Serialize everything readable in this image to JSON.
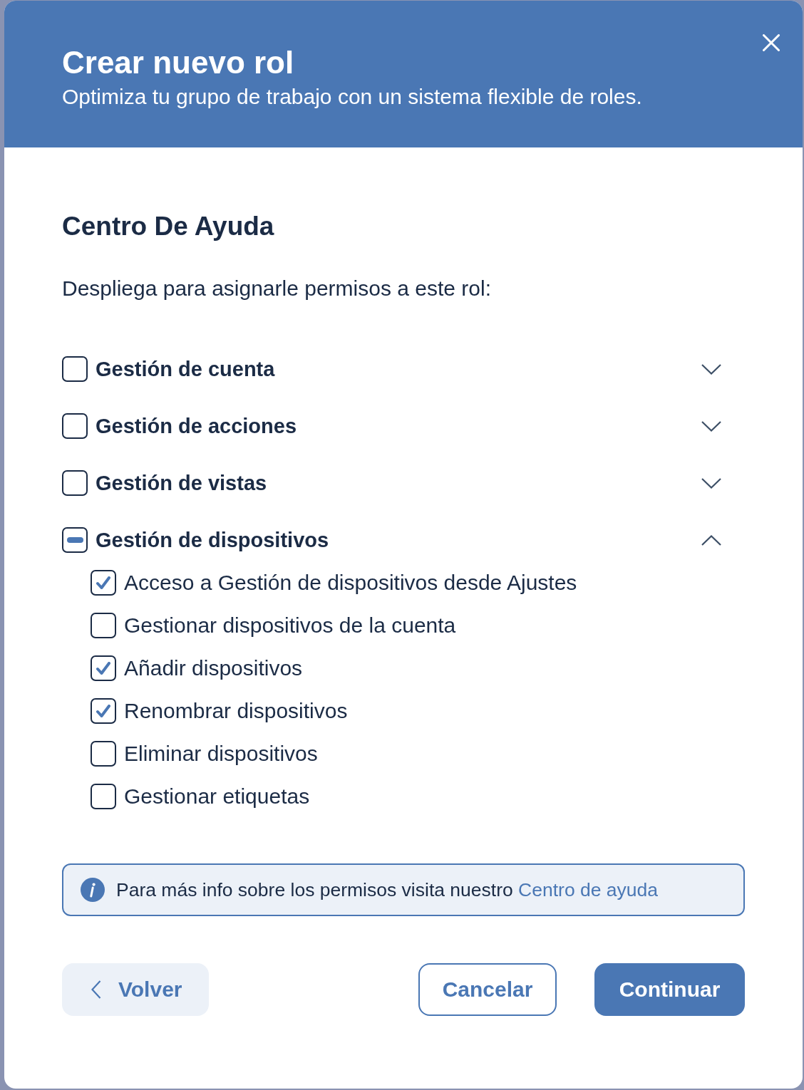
{
  "dialog": {
    "title": "Crear nuevo rol",
    "subtitle": "Optimiza tu grupo de trabajo con un sistema flexible de roles."
  },
  "section": {
    "title": "Centro De Ayuda",
    "instruction": "Despliega para asignarle permisos a este rol:"
  },
  "permission_groups": [
    {
      "label": "Gestión de cuenta",
      "checked": false,
      "indeterminate": false,
      "expanded": false
    },
    {
      "label": "Gestión de acciones",
      "checked": false,
      "indeterminate": false,
      "expanded": false
    },
    {
      "label": "Gestión de vistas",
      "checked": false,
      "indeterminate": false,
      "expanded": false
    },
    {
      "label": "Gestión de dispositivos",
      "checked": false,
      "indeterminate": true,
      "expanded": true,
      "children": [
        {
          "label": "Acceso a Gestión de dispositivos desde Ajustes",
          "checked": true
        },
        {
          "label": "Gestionar dispositivos de la cuenta",
          "checked": false
        },
        {
          "label": "Añadir dispositivos",
          "checked": true
        },
        {
          "label": "Renombrar dispositivos",
          "checked": true
        },
        {
          "label": "Eliminar dispositivos",
          "checked": false
        },
        {
          "label": "Gestionar etiquetas",
          "checked": false
        }
      ]
    }
  ],
  "info": {
    "text": "Para más info sobre los permisos visita nuestro",
    "link": "Centro de ayuda"
  },
  "buttons": [
    {
      "label": "Volver",
      "kind": "back"
    },
    {
      "label": "Cancelar",
      "kind": "secondary"
    },
    {
      "label": "Continuar",
      "kind": "primary"
    }
  ]
}
